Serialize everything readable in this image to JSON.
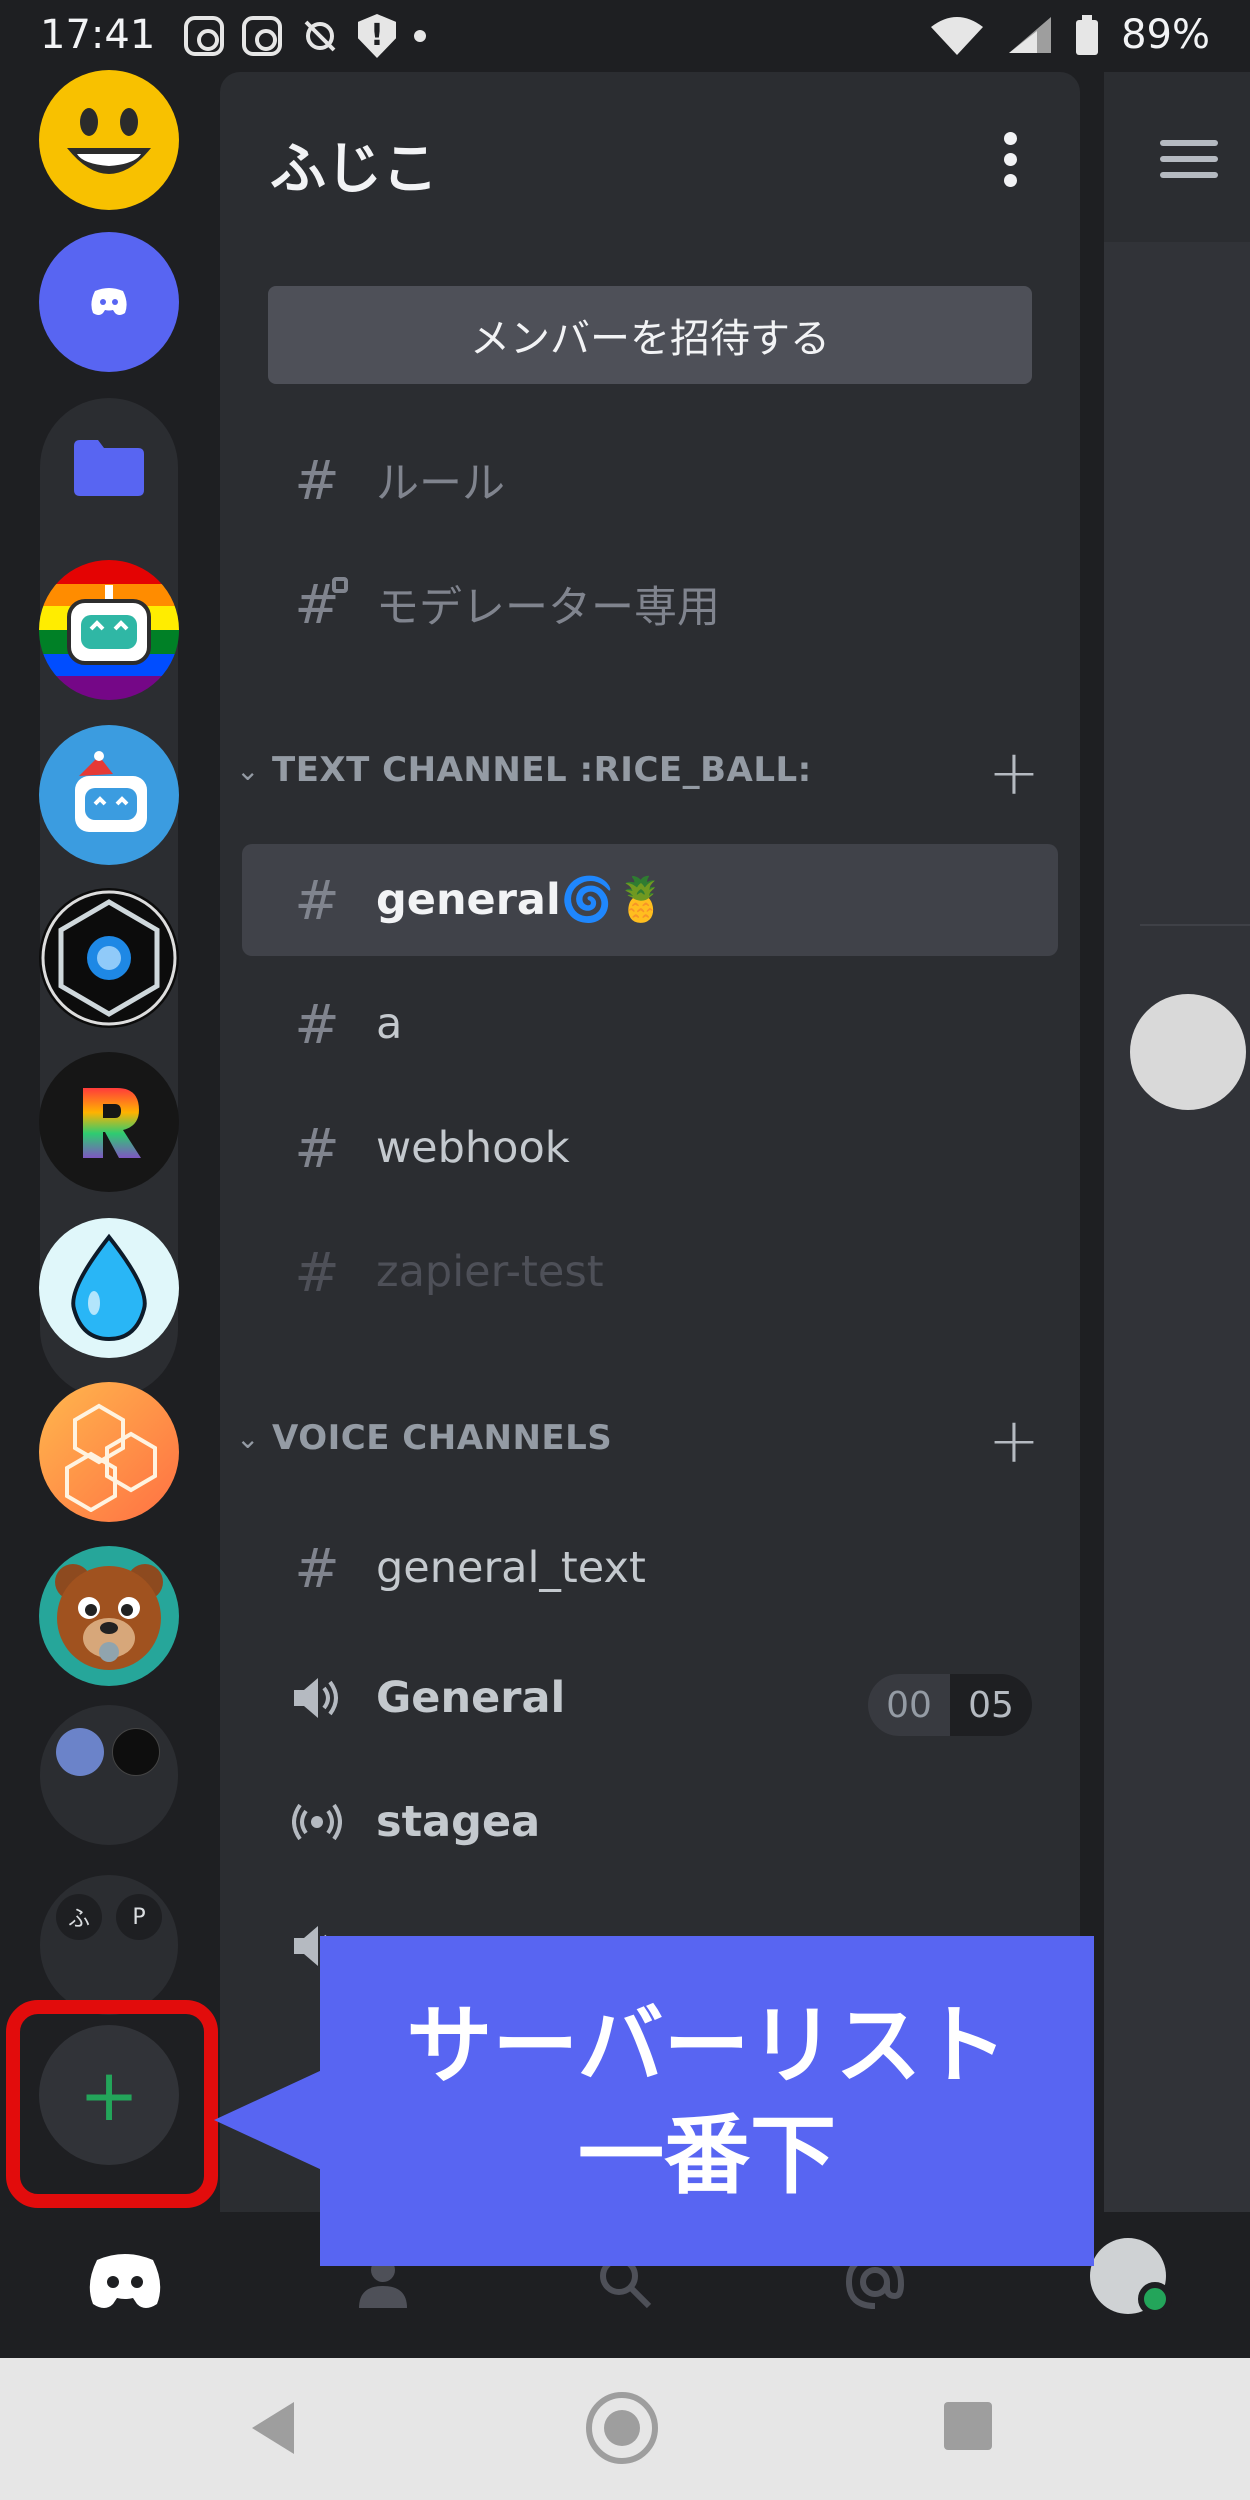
{
  "status_bar": {
    "time": "17:41",
    "battery": "89%",
    "icons": [
      "instagram-icon",
      "instagram-icon",
      "mute-icon",
      "shield-alert-icon",
      "notification-dot-icon",
      "wifi-icon",
      "signal-icon",
      "battery-icon"
    ]
  },
  "server_rail": {
    "servers": [
      {
        "name": "smiley-server",
        "icon": "smiley-face-icon"
      },
      {
        "name": "discord-server",
        "icon": "discord-logo-icon"
      },
      {
        "name": "folder",
        "icon": "folder-icon"
      },
      {
        "name": "rainbow-bot-server",
        "icon": "robot-icon"
      },
      {
        "name": "blue-bot-server",
        "icon": "robot-icon"
      },
      {
        "name": "aperture-server",
        "icon": "aperture-icon"
      },
      {
        "name": "r-server",
        "icon": "r-letter-icon"
      },
      {
        "name": "droplet-server",
        "icon": "water-drop-icon"
      },
      {
        "name": "hexagon-server",
        "icon": "hexagon-icon"
      },
      {
        "name": "bear-server",
        "icon": "bear-icon"
      },
      {
        "name": "mini-folder-a",
        "icon": "folder-icon"
      },
      {
        "name": "mini-folder-b",
        "icon": "folder-icon"
      }
    ],
    "mini_folder_b_labels": [
      "ふ",
      "P"
    ],
    "add_server_symbol": "+"
  },
  "channel_panel": {
    "server_name": "ふじこ",
    "invite_button": "メンバーを招待する",
    "channels_top": [
      {
        "name": "ルール",
        "icon": "hash-icon"
      },
      {
        "name": "モデレーター専用",
        "icon": "hash-lock-icon"
      }
    ],
    "categories": [
      {
        "name": "TEXT CHANNEL :RICE_BALL:",
        "channels": [
          {
            "name": "general🌀🍍",
            "icon": "hash-icon",
            "active": true
          },
          {
            "name": "a",
            "icon": "hash-icon"
          },
          {
            "name": "webhook",
            "icon": "hash-icon"
          },
          {
            "name": "zapier-test",
            "icon": "hash-icon",
            "muted": true
          }
        ]
      },
      {
        "name": "VOICE CHANNELS",
        "channels": [
          {
            "name": "general_text",
            "icon": "hash-icon"
          },
          {
            "name": "General",
            "icon": "speaker-icon",
            "badge": [
              "00",
              "05"
            ]
          },
          {
            "name": "stagea",
            "icon": "stage-icon"
          },
          {
            "name": "",
            "icon": "speaker-icon"
          }
        ]
      }
    ]
  },
  "callout": {
    "line1": "サーバーリスト",
    "line2": "一番下"
  },
  "colors": {
    "accent": "#5865f2",
    "highlight": "#e20c0c",
    "online": "#23a55a"
  }
}
